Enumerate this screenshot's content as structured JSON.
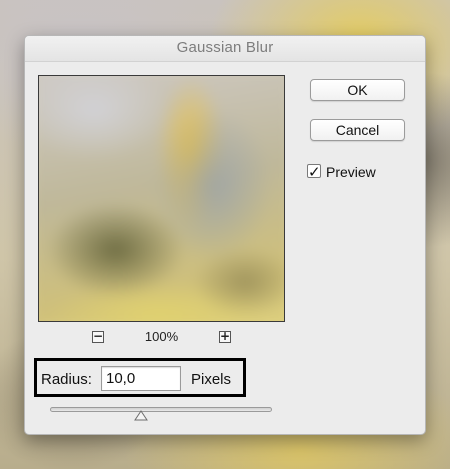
{
  "dialog": {
    "title": "Gaussian Blur",
    "buttons": {
      "ok": "OK",
      "cancel": "Cancel"
    },
    "preview_checkbox": {
      "label": "Preview",
      "checked": true
    },
    "zoom": {
      "out_symbol": "−",
      "in_symbol": "+",
      "level": "100%"
    },
    "radius": {
      "label": "Radius:",
      "value": "10,0",
      "unit": "Pixels"
    },
    "slider": {
      "position_fraction": 0.41
    }
  },
  "icons": {
    "zoom_out": "minus-icon",
    "zoom_in": "plus-icon",
    "check": "checkmark-icon",
    "slider_thumb": "triangle-thumb-icon"
  }
}
